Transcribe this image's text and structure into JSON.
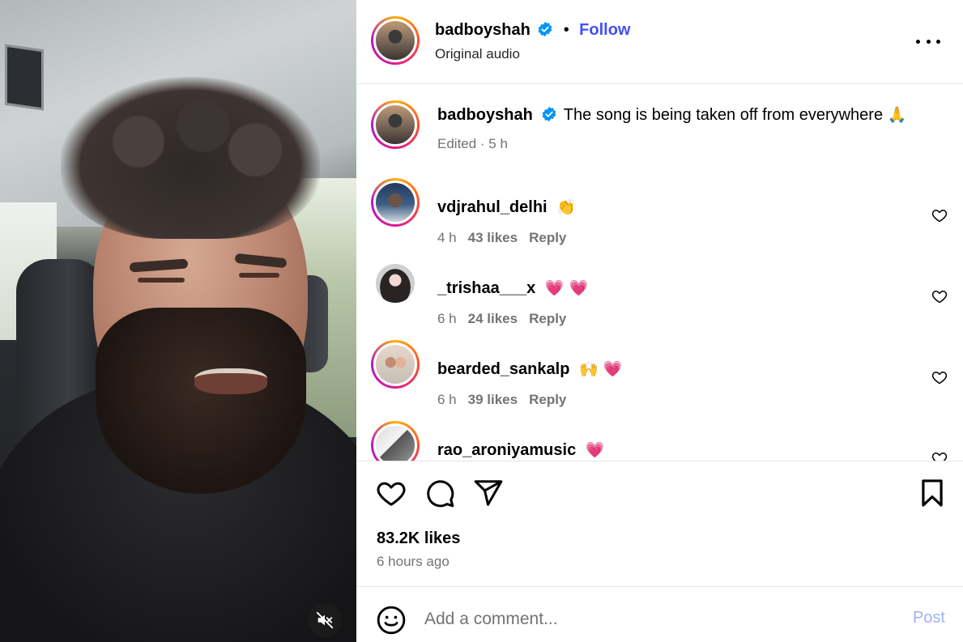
{
  "post": {
    "author": "badboyshah",
    "verified": true,
    "follow_label": "Follow",
    "separator": "•",
    "audio": "Original audio"
  },
  "caption": {
    "username": "badboyshah",
    "text": "The song is being taken off from everywhere",
    "emoji": "🙏",
    "meta": "Edited · 5 h"
  },
  "comments": [
    {
      "username": "vdjrahul_delhi",
      "text": "",
      "emoji": "👏",
      "time": "4 h",
      "likes": "43 likes",
      "reply": "Reply",
      "ring": true
    },
    {
      "username": "_trishaa___x",
      "text": "",
      "emoji": "💗 💗",
      "time": "6 h",
      "likes": "24 likes",
      "reply": "Reply",
      "ring": false
    },
    {
      "username": "bearded_sankalp",
      "text": "",
      "emoji": "🙌 💗",
      "time": "6 h",
      "likes": "39 likes",
      "reply": "Reply",
      "ring": true
    },
    {
      "username": "rao_aroniyamusic",
      "text": "",
      "emoji": "💗",
      "time": "",
      "likes": "",
      "reply": "",
      "ring": true
    }
  ],
  "stats": {
    "likes": "83.2K likes",
    "time_ago": "6 hours ago"
  },
  "comment_box": {
    "placeholder": "Add a comment...",
    "post_label": "Post"
  },
  "colors": {
    "follow": "#4150f7",
    "verified": "#0095f6",
    "post_disabled": "#9db2f5",
    "muted_text": "#737373"
  },
  "icons": [
    "verified-badge-icon",
    "more-options-icon",
    "heart-icon",
    "comment-icon",
    "share-icon",
    "bookmark-icon",
    "emoji-icon",
    "mute-icon"
  ]
}
